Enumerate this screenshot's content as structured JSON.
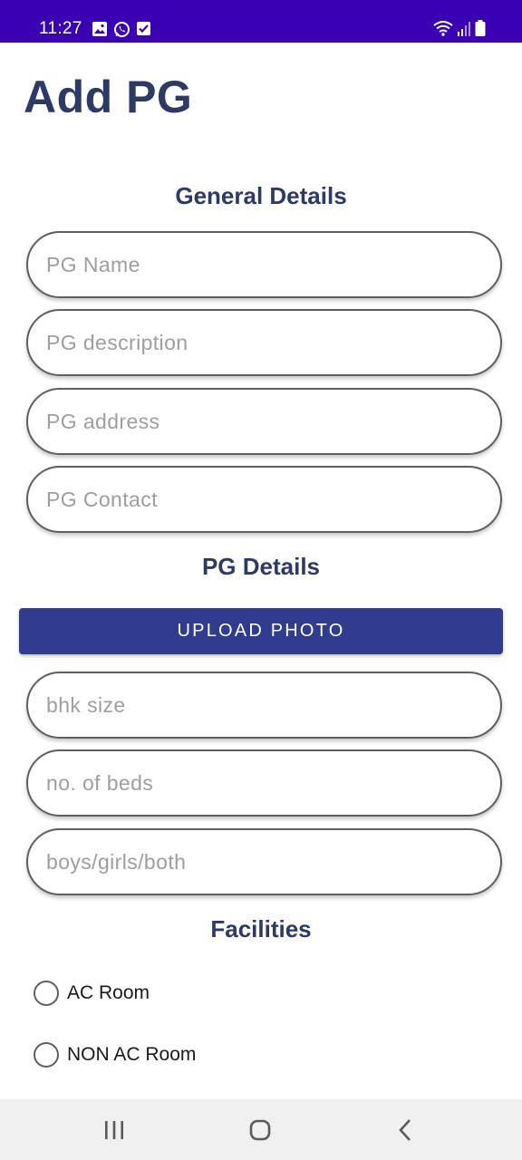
{
  "status_bar": {
    "time": "11:27",
    "left_icons": [
      "image-icon",
      "whatsapp-icon",
      "checkbox-icon"
    ],
    "right_icons": [
      "wifi-icon",
      "signal-icon",
      "battery-icon"
    ]
  },
  "page": {
    "title": "Add PG"
  },
  "general_details": {
    "heading": "General Details",
    "fields": [
      {
        "placeholder": "PG Name",
        "value": ""
      },
      {
        "placeholder": "PG description",
        "value": ""
      },
      {
        "placeholder": "PG address",
        "value": ""
      },
      {
        "placeholder": "PG Contact",
        "value": ""
      }
    ]
  },
  "pg_details": {
    "heading": "PG Details",
    "upload_label": "UPLOAD PHOTO",
    "fields": [
      {
        "placeholder": "bhk size",
        "value": ""
      },
      {
        "placeholder": "no. of beds",
        "value": ""
      },
      {
        "placeholder": "boys/girls/both",
        "value": ""
      }
    ]
  },
  "facilities": {
    "heading": "Facilities",
    "options": [
      {
        "label": "AC Room",
        "selected": false
      },
      {
        "label": "NON AC Room",
        "selected": false
      }
    ]
  },
  "nav_bar": {
    "buttons": [
      "recent-apps-icon",
      "home-icon",
      "back-icon"
    ]
  },
  "colors": {
    "status_bar": "#3a00b3",
    "heading": "#2e3a66",
    "button": "#2f3c8f"
  }
}
